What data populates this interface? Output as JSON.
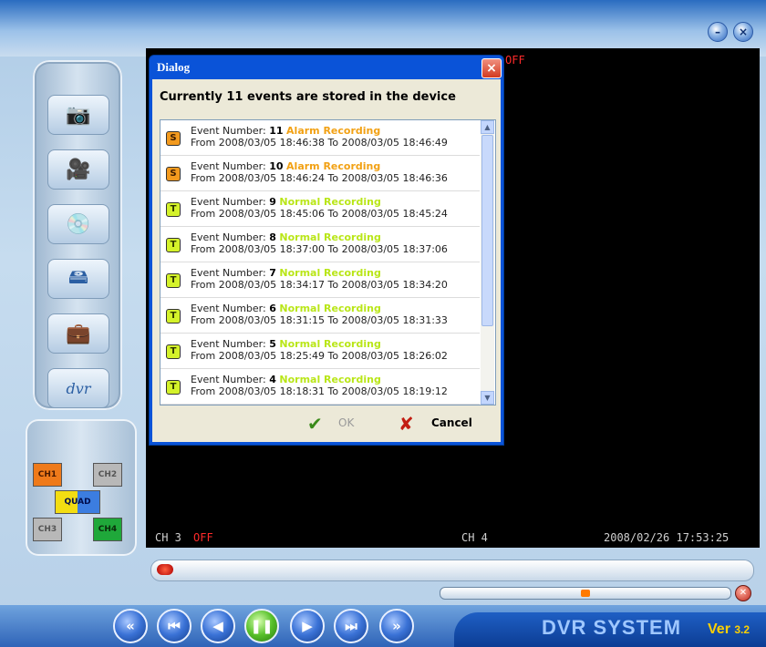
{
  "window": {
    "minimize_icon": "minimize-icon",
    "close_icon": "close-icon"
  },
  "video": {
    "top_status": "OFF",
    "ch3_label": "CH 3",
    "ch3_status": "OFF",
    "ch4_label": "CH 4",
    "timestamp": "2008/02/26 17:53:25"
  },
  "channels": {
    "ch1": "CH1",
    "ch2": "CH2",
    "quad": "QUAD",
    "ch3": "CH3",
    "ch4": "CH4"
  },
  "dialog": {
    "title": "Dialog",
    "message": "Currently 11 events are stored in the device",
    "ok_label": "OK",
    "cancel_label": "Cancel",
    "events": [
      {
        "badge": "S",
        "prefix": "Event Number: ",
        "number": "11",
        "type": "Alarm Recording",
        "range": "From 2008/03/05 18:46:38 To 2008/03/05 18:46:49"
      },
      {
        "badge": "S",
        "prefix": "Event Number: ",
        "number": "10",
        "type": "Alarm Recording",
        "range": "From 2008/03/05 18:46:24 To 2008/03/05 18:46:36"
      },
      {
        "badge": "T",
        "prefix": "Event Number: ",
        "number": "9",
        "type": "Normal Recording",
        "range": "From 2008/03/05 18:45:06 To 2008/03/05 18:45:24"
      },
      {
        "badge": "T",
        "prefix": "Event Number: ",
        "number": "8",
        "type": "Normal Recording",
        "range": "From 2008/03/05 18:37:00 To 2008/03/05 18:37:06"
      },
      {
        "badge": "T",
        "prefix": "Event Number: ",
        "number": "7",
        "type": "Normal Recording",
        "range": "From 2008/03/05 18:34:17 To 2008/03/05 18:34:20"
      },
      {
        "badge": "T",
        "prefix": "Event Number: ",
        "number": "6",
        "type": "Normal Recording",
        "range": "From 2008/03/05 18:31:15 To 2008/03/05 18:31:33"
      },
      {
        "badge": "T",
        "prefix": "Event Number: ",
        "number": "5",
        "type": "Normal Recording",
        "range": "From 2008/03/05 18:25:49 To 2008/03/05 18:26:02"
      },
      {
        "badge": "T",
        "prefix": "Event Number: ",
        "number": "4",
        "type": "Normal Recording",
        "range": "From 2008/03/05 18:18:31 To 2008/03/05 18:19:12"
      }
    ]
  },
  "brand": {
    "name": "DVR SYSTEM",
    "version_prefix": "Ver",
    "version_number": "3.2"
  },
  "colors": {
    "alarm": "#f2a114",
    "normal": "#b9e617",
    "off": "#ff2a2a",
    "title_bar": "#0a53d8"
  }
}
